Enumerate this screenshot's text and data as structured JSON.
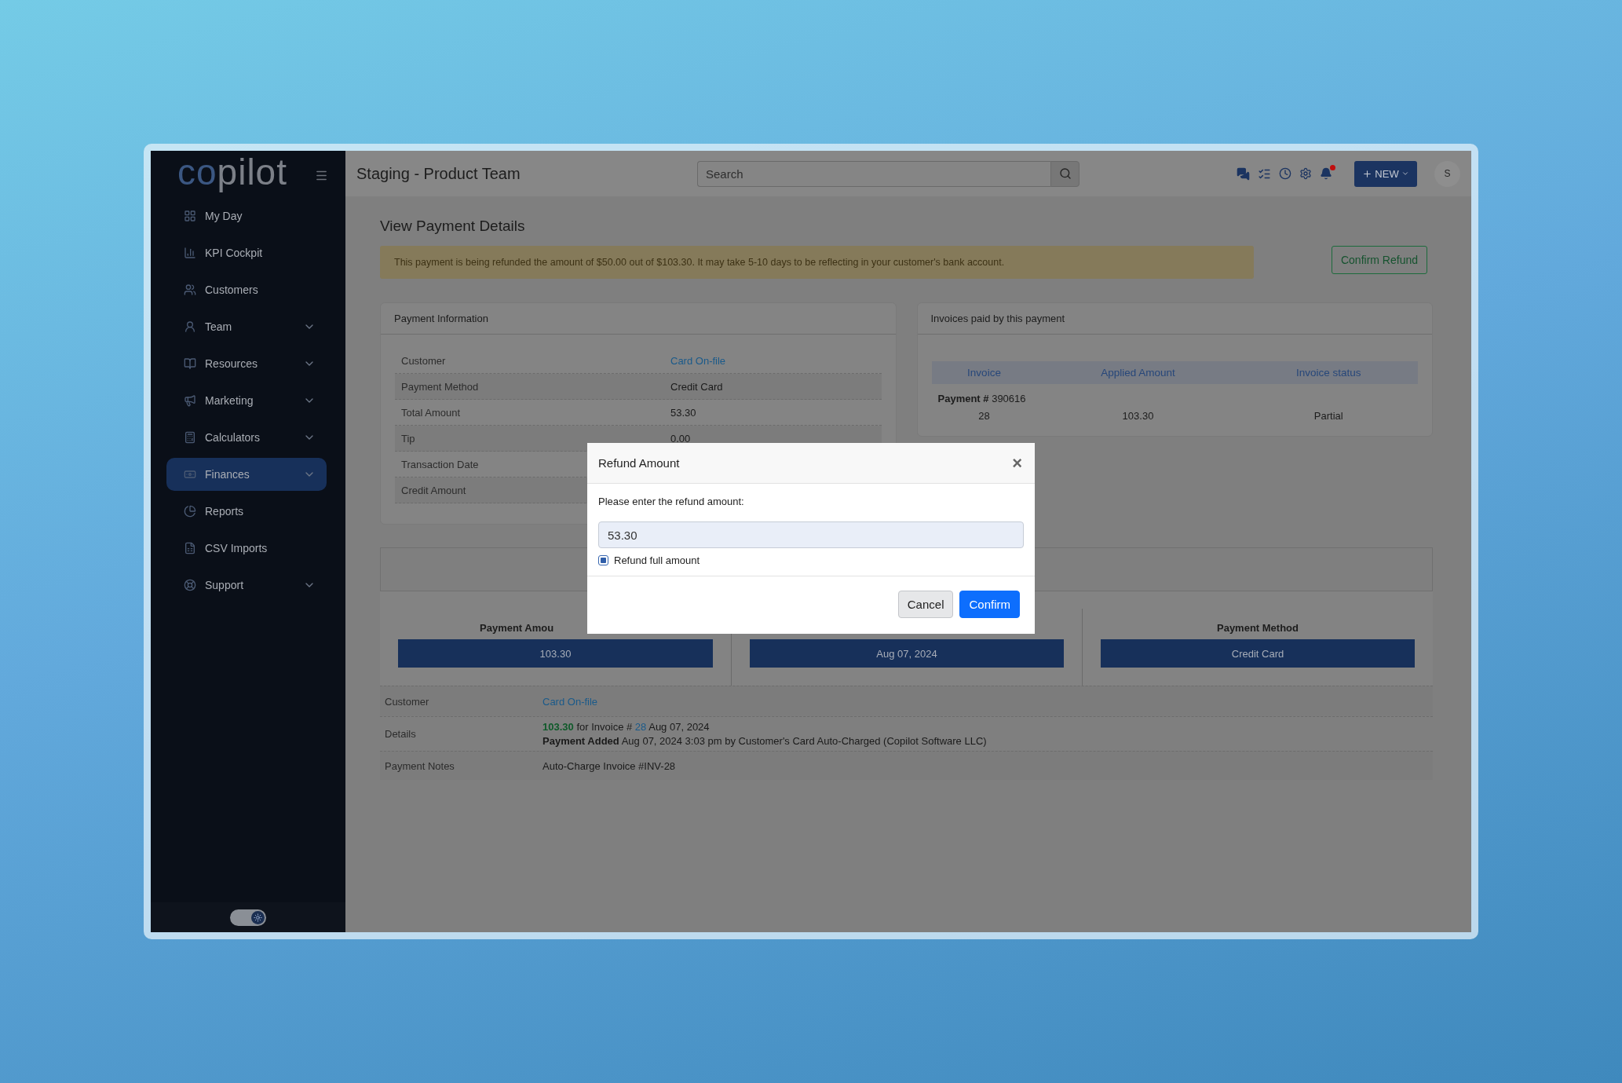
{
  "sidebar": {
    "logo": {
      "part_1": "co",
      "part_2": "pilot"
    },
    "items": [
      {
        "label": "My Day",
        "expandable": false,
        "selected": false
      },
      {
        "label": "KPI Cockpit",
        "expandable": false,
        "selected": false
      },
      {
        "label": "Customers",
        "expandable": false,
        "selected": false
      },
      {
        "label": "Team",
        "expandable": true,
        "selected": false
      },
      {
        "label": "Resources",
        "expandable": true,
        "selected": false
      },
      {
        "label": "Marketing",
        "expandable": true,
        "selected": false
      },
      {
        "label": "Calculators",
        "expandable": true,
        "selected": false
      },
      {
        "label": "Finances",
        "expandable": true,
        "selected": true
      },
      {
        "label": "Reports",
        "expandable": false,
        "selected": false
      },
      {
        "label": "CSV Imports",
        "expandable": false,
        "selected": false
      },
      {
        "label": "Support",
        "expandable": true,
        "selected": false
      }
    ],
    "theme_switch": {
      "on": true
    }
  },
  "header": {
    "title": "Staging - Product Team",
    "search": {
      "placeholder": "Search"
    },
    "notifications": {
      "unread": true
    },
    "new_button": "NEW",
    "avatar": "S"
  },
  "page": {
    "heading": "View Payment Details",
    "alert": "This payment is being refunded the amount of $50.00 out of $103.30. It may take 5-10 days to be reflecting in your customer's bank account.",
    "confirm_refund": "Confirm Refund",
    "payment_information": {
      "title": "Payment Information",
      "rows": [
        {
          "label": "Customer",
          "value": "Card On-file",
          "kind": "link"
        },
        {
          "label": "Payment Method",
          "value": "Credit Card",
          "kind": "text"
        },
        {
          "label": "Total Amount",
          "value": "53.30",
          "kind": "text"
        },
        {
          "label": "Tip",
          "value": "0.00",
          "kind": "text"
        },
        {
          "label": "Transaction Date"
        },
        {
          "label": "Credit Amount"
        }
      ]
    },
    "invoices": {
      "title": "Invoices paid by this payment",
      "columns": [
        "Invoice",
        "Applied Amount",
        "Invoice status"
      ],
      "group": "**Payment #** 390616",
      "rows": [
        [
          "28",
          "103.30",
          "Partial"
        ]
      ]
    },
    "summary": {
      "tiles": [
        {
          "label": "Payment Amou",
          "value": "103.30"
        },
        {
          "value": "Aug 07, 2024"
        },
        {
          "label": "Payment Method",
          "value": "Credit Card"
        }
      ]
    },
    "details": {
      "customer": {
        "label": "Customer",
        "value": "Card On-file"
      },
      "details": {
        "label": "Details",
        "amount": "103.30",
        "for_text": "for Invoice #",
        "invoice": "28",
        "date": "Aug 07, 2024",
        "line_2": "**Payment Added** Aug 07, 2024 3:03 pm by Customer's Card Auto-Charged (Copilot Software LLC)"
      },
      "notes": {
        "label": "Payment Notes",
        "value": "Auto-Charge Invoice #INV-28"
      }
    }
  },
  "modal": {
    "title": "Refund Amount",
    "close": "×",
    "prompt": "Please enter the refund amount:",
    "value": "53.30",
    "checkbox": {
      "label": "Refund full amount",
      "checked": true
    },
    "buttons": [
      {
        "label": "Cancel",
        "kind": "secondary"
      },
      {
        "label": "Confirm",
        "kind": "primary"
      }
    ]
  }
}
